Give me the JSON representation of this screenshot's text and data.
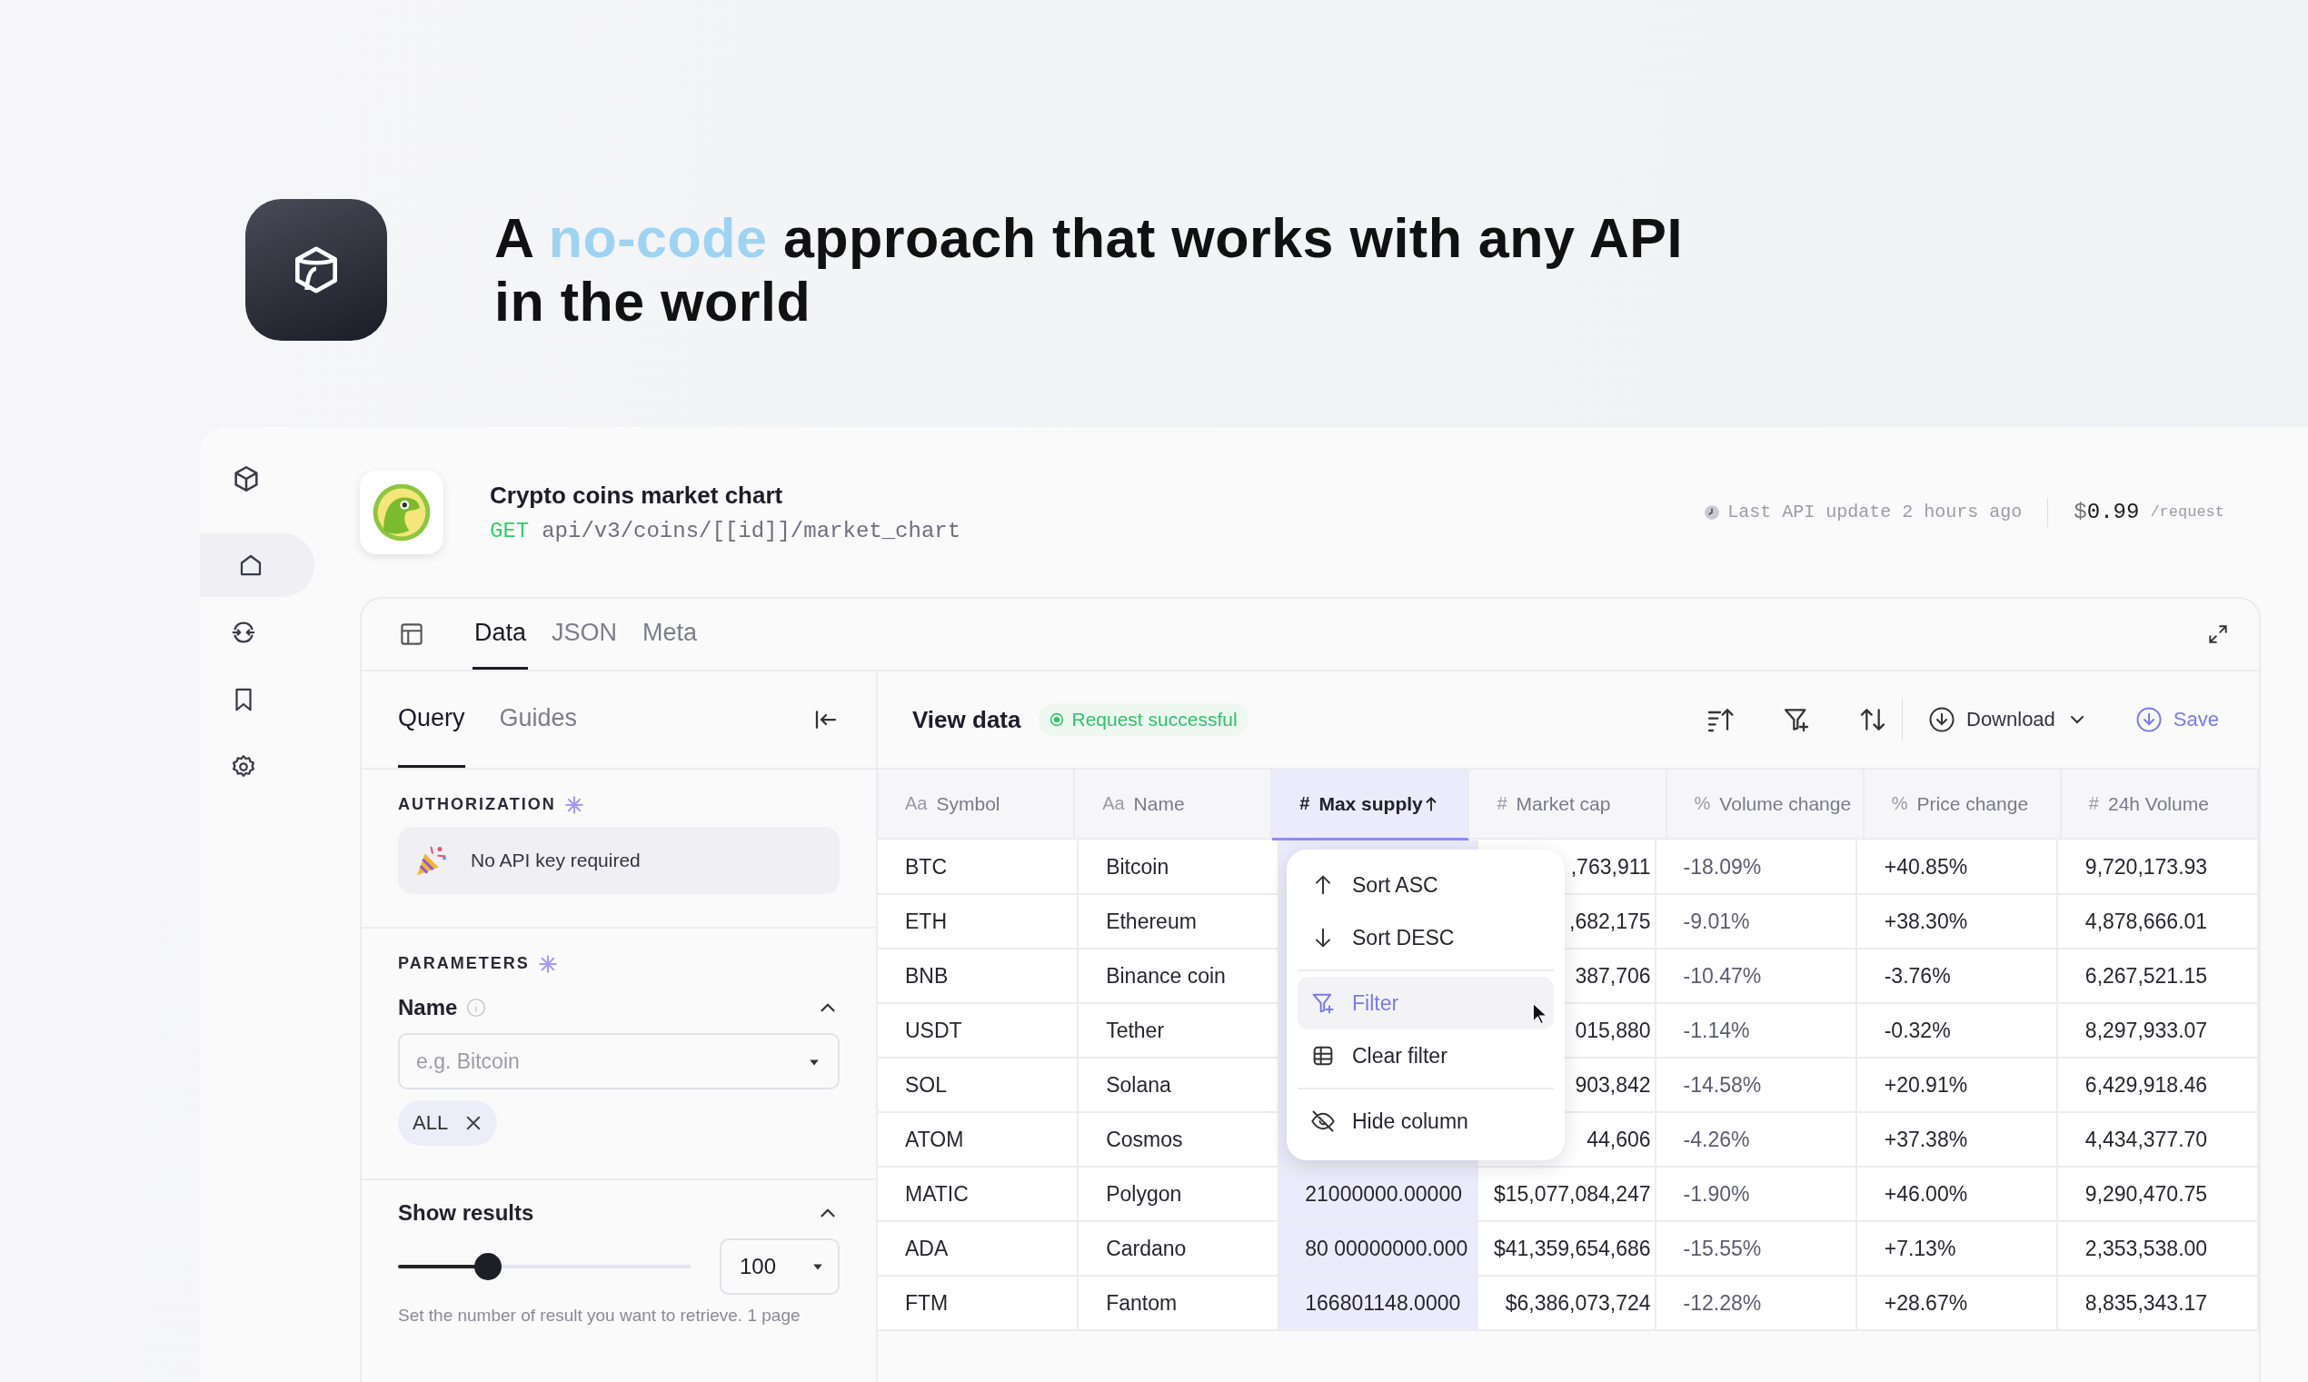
{
  "hero": {
    "title_start": "A",
    "title_highlight": "no-code",
    "title_end": "approach that works with any API in the world"
  },
  "sidebar": {
    "items": [
      {
        "selected": true
      },
      {
        "selected": false
      },
      {
        "selected": false
      },
      {
        "selected": false
      }
    ]
  },
  "endpoint": {
    "title": "Crypto coins market chart",
    "method": "GET",
    "path": "api/v3/coins/[[id]]/market_chart",
    "last_update": "Last API update 2 hours ago",
    "currency": "$",
    "price": "0.99",
    "unit": "/request"
  },
  "main_tabs": [
    {
      "label": "Data",
      "selected": true
    },
    {
      "label": "JSON",
      "selected": false
    },
    {
      "label": "Meta",
      "selected": false
    }
  ],
  "query_panel": {
    "tabs": [
      {
        "label": "Query",
        "selected": true
      },
      {
        "label": "Guides",
        "selected": false
      }
    ],
    "authorization": {
      "heading": "AUTHORIZATION",
      "note": "No API key required"
    },
    "parameters": {
      "heading": "PARAMETERS",
      "name_label": "Name",
      "expanded": true,
      "placeholder": "e.g. Bitcoin",
      "chips": [
        "ALL"
      ]
    },
    "results": {
      "heading": "Show results",
      "expanded": true,
      "level": 0.28,
      "value": "100",
      "help": "Set the number of result you want to retrieve. 1 page"
    }
  },
  "data_view": {
    "title": "View data",
    "status": "Request successful",
    "download": "Download",
    "save": "Save",
    "columns": [
      {
        "icon": "Aa",
        "label": "Symbol",
        "selected": false
      },
      {
        "icon": "Aa",
        "label": "Name",
        "selected": false
      },
      {
        "icon": "#",
        "label": "Max supply",
        "selected": true
      },
      {
        "icon": "#",
        "label": "Market cap",
        "selected": false
      },
      {
        "icon": "%",
        "label": "Volume change",
        "selected": false
      },
      {
        "icon": "%",
        "label": "Price change",
        "selected": false
      },
      {
        "icon": "#",
        "label": "24h Volume",
        "selected": false
      }
    ],
    "rows": [
      {
        "symbol": "BTC",
        "name": "Bitcoin",
        "market_cap": ",763,911",
        "volume_change": "-18.09%",
        "price_change": "+40.85%",
        "volume_24h": "9,720,173.93"
      },
      {
        "symbol": "ETH",
        "name": "Ethereum",
        "market_cap": ",682,175",
        "volume_change": "-9.01%",
        "price_change": "+38.30%",
        "volume_24h": "4,878,666.01"
      },
      {
        "symbol": "BNB",
        "name": "Binance coin",
        "market_cap": "387,706",
        "volume_change": "-10.47%",
        "price_change": "-3.76%",
        "volume_24h": "6,267,521.15"
      },
      {
        "symbol": "USDT",
        "name": "Tether",
        "market_cap": "015,880",
        "volume_change": "-1.14%",
        "price_change": "-0.32%",
        "volume_24h": "8,297,933.07"
      },
      {
        "symbol": "SOL",
        "name": "Solana",
        "market_cap": "903,842",
        "volume_change": "-14.58%",
        "price_change": "+20.91%",
        "volume_24h": "6,429,918.46"
      },
      {
        "symbol": "ATOM",
        "name": "Cosmos",
        "market_cap": "44,606",
        "volume_change": "-4.26%",
        "price_change": "+37.38%",
        "volume_24h": "4,434,377.70"
      },
      {
        "symbol": "MATIC",
        "name": "Polygon",
        "max_supply": "21000000.00000",
        "market_cap": "$15,077,084,247",
        "volume_change": "-1.90%",
        "price_change": "+46.00%",
        "volume_24h": "9,290,470.75"
      },
      {
        "symbol": "ADA",
        "name": "Cardano",
        "max_supply": "80 00000000.000",
        "market_cap": "$41,359,654,686",
        "volume_change": "-15.55%",
        "price_change": "+7.13%",
        "volume_24h": "2,353,538.00"
      },
      {
        "symbol": "FTM",
        "name": "Fantom",
        "max_supply": "166801148.0000",
        "market_cap": "$6,386,073,724",
        "volume_change": "-12.28%",
        "price_change": "+28.67%",
        "volume_24h": "8,835,343.17"
      }
    ],
    "column_menu": [
      {
        "label": "Sort ASC",
        "selected": false
      },
      {
        "label": "Sort DESC",
        "selected": false
      },
      {
        "label": "Filter",
        "selected": true
      },
      {
        "label": "Clear filter",
        "selected": false
      },
      {
        "label": "Hide column",
        "selected": false
      }
    ]
  }
}
